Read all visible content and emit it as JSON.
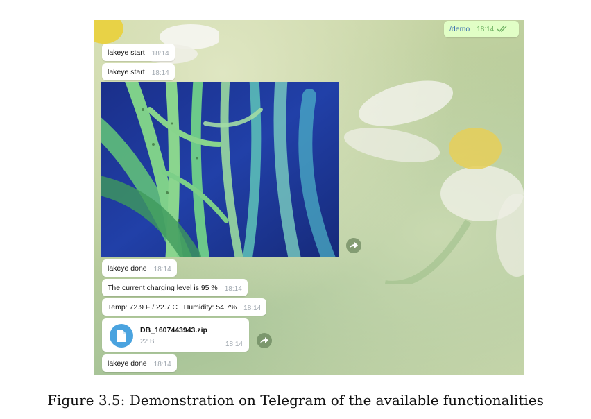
{
  "chat": {
    "outgoing": {
      "text": "/demo",
      "time": "18:14"
    },
    "messages": [
      {
        "text": "lakeye start",
        "time": "18:14"
      },
      {
        "text": "lakeye start",
        "time": "18:14"
      },
      {
        "text": "lakeye done",
        "time": "18:14"
      },
      {
        "text": "The current charging level is 95 %",
        "time": "18:14"
      },
      {
        "text": "Temp: 72.9 F / 22.7 C   Humidity: 54.7%",
        "time": "18:14"
      },
      {
        "text": "lakeye done",
        "time": "18:14"
      }
    ],
    "file": {
      "name": "DB_1607443943.zip",
      "size": "22 B",
      "time": "18:14"
    }
  },
  "caption": "Figure 3.5: Demonstration on Telegram of the available functionalities",
  "colors": {
    "outgoing_bubble": "#e1fec6",
    "file_icon": "#4aa3df",
    "link": "#3a6fb0"
  }
}
